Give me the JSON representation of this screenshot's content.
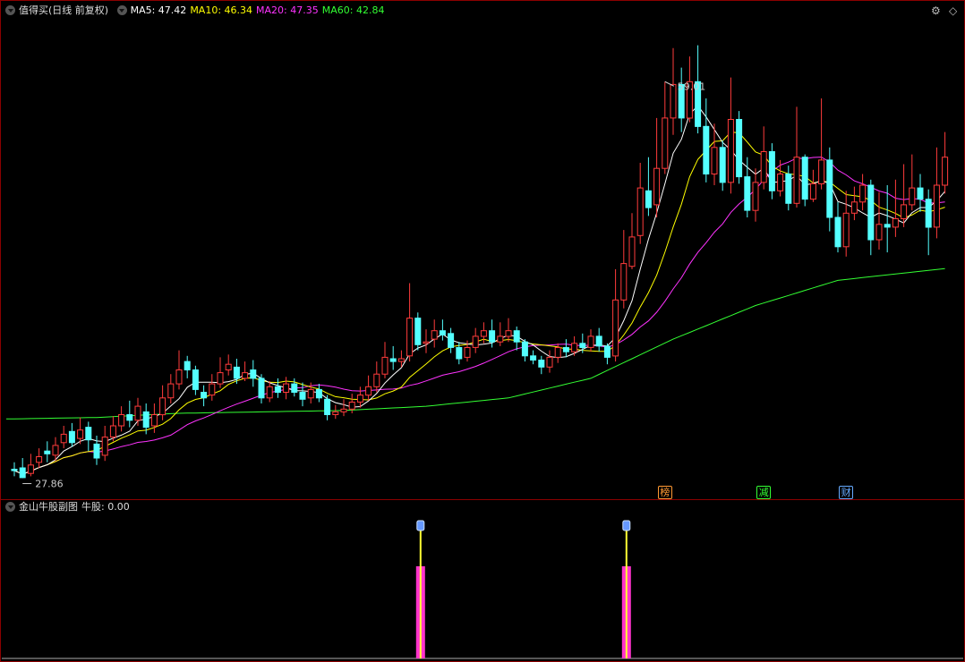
{
  "header": {
    "title": "值得买(日线 前复权)",
    "ma": [
      {
        "label": "MA5: 47.42",
        "color": "#ffffff"
      },
      {
        "label": "MA10: 46.34",
        "color": "#ffff00"
      },
      {
        "label": "MA20: 47.35",
        "color": "#ff33ff"
      },
      {
        "label": "MA60: 42.84",
        "color": "#33ff33"
      }
    ]
  },
  "sub_header": {
    "title": "金山牛股副图",
    "value_label": "牛股: 0.00"
  },
  "controls": {
    "settings_icon": "gear-icon",
    "diamond_icon": "diamond-icon"
  },
  "event_tags": [
    {
      "text": "榜",
      "color": "#ff9933",
      "candle_index": 79
    },
    {
      "text": "减",
      "color": "#33ff33",
      "candle_index": 91
    },
    {
      "text": "财",
      "color": "#66aaff",
      "candle_index": 101
    }
  ],
  "colors": {
    "up": "#ff3b3b",
    "down": "#54ffff",
    "background": "#000000",
    "border": "#8b0000"
  },
  "chart_data": {
    "type": "candlestick",
    "price_range": [
      27,
      60.5
    ],
    "max_label": "59.01",
    "min_label": "27.86",
    "max_index": 79,
    "min_index": 1,
    "candles": [
      [
        28.5,
        28.4,
        29.0,
        28.0
      ],
      [
        28.6,
        27.9,
        29.3,
        27.86
      ],
      [
        28.2,
        28.8,
        29.6,
        28.0
      ],
      [
        29.0,
        29.4,
        30.0,
        28.6
      ],
      [
        29.8,
        29.6,
        30.5,
        29.0
      ],
      [
        29.5,
        30.2,
        30.8,
        29.1
      ],
      [
        30.4,
        31.0,
        31.6,
        30.0
      ],
      [
        31.2,
        30.4,
        31.8,
        30.1
      ],
      [
        30.7,
        31.3,
        32.2,
        30.3
      ],
      [
        31.5,
        30.6,
        31.9,
        29.8
      ],
      [
        30.3,
        29.3,
        30.9,
        28.8
      ],
      [
        29.5,
        30.8,
        31.6,
        29.1
      ],
      [
        30.8,
        31.6,
        32.3,
        30.5
      ],
      [
        31.6,
        32.4,
        33.0,
        31.2
      ],
      [
        32.4,
        32.0,
        33.4,
        31.5
      ],
      [
        32.0,
        33.0,
        33.6,
        31.6
      ],
      [
        32.6,
        31.5,
        33.2,
        31.0
      ],
      [
        31.6,
        32.4,
        33.2,
        31.1
      ],
      [
        32.4,
        33.6,
        34.5,
        32.0
      ],
      [
        33.6,
        34.6,
        35.3,
        33.2
      ],
      [
        34.6,
        35.6,
        37.0,
        34.2
      ],
      [
        36.2,
        35.6,
        36.6,
        35.0
      ],
      [
        35.6,
        34.2,
        35.9,
        33.8
      ],
      [
        34.0,
        33.6,
        34.5,
        33.0
      ],
      [
        33.8,
        34.6,
        35.3,
        33.4
      ],
      [
        34.6,
        35.4,
        36.5,
        34.3
      ],
      [
        35.6,
        36.0,
        36.7,
        35.2
      ],
      [
        35.8,
        35.0,
        36.4,
        34.6
      ],
      [
        35.0,
        35.4,
        36.2,
        34.8
      ],
      [
        35.6,
        35.0,
        36.3,
        34.4
      ],
      [
        35.0,
        33.6,
        35.3,
        33.2
      ],
      [
        33.6,
        34.4,
        34.8,
        33.3
      ],
      [
        34.4,
        34.0,
        35.0,
        33.6
      ],
      [
        34.0,
        34.6,
        35.1,
        33.5
      ],
      [
        34.6,
        34.0,
        35.0,
        33.7
      ],
      [
        34.0,
        33.5,
        34.7,
        33.0
      ],
      [
        33.6,
        34.2,
        34.7,
        33.2
      ],
      [
        34.2,
        33.6,
        34.6,
        33.3
      ],
      [
        33.5,
        32.4,
        33.8,
        32.0
      ],
      [
        32.4,
        32.6,
        33.1,
        32.1
      ],
      [
        32.6,
        32.8,
        33.5,
        32.3
      ],
      [
        32.8,
        33.3,
        33.9,
        32.5
      ],
      [
        33.3,
        33.8,
        34.4,
        32.9
      ],
      [
        33.8,
        34.4,
        35.2,
        33.4
      ],
      [
        34.4,
        35.3,
        36.2,
        34.0
      ],
      [
        35.3,
        36.5,
        37.6,
        35.0
      ],
      [
        36.4,
        36.2,
        37.3,
        35.6
      ],
      [
        36.2,
        36.4,
        37.0,
        35.8
      ],
      [
        36.6,
        39.3,
        41.8,
        36.2
      ],
      [
        39.3,
        37.4,
        39.7,
        37.0
      ],
      [
        37.5,
        37.6,
        38.5,
        36.8
      ],
      [
        37.8,
        38.4,
        39.2,
        37.2
      ],
      [
        38.4,
        38.1,
        39.2,
        37.7
      ],
      [
        38.2,
        37.2,
        38.6,
        36.8
      ],
      [
        37.2,
        36.4,
        37.6,
        36.0
      ],
      [
        36.5,
        37.2,
        37.7,
        36.2
      ],
      [
        37.2,
        38.0,
        38.6,
        36.8
      ],
      [
        38.0,
        38.4,
        39.0,
        37.5
      ],
      [
        38.4,
        37.6,
        39.2,
        37.2
      ],
      [
        37.6,
        38.0,
        39.0,
        37.3
      ],
      [
        38.0,
        38.4,
        39.3,
        37.6
      ],
      [
        38.4,
        37.6,
        38.7,
        37.0
      ],
      [
        37.6,
        36.6,
        37.8,
        36.2
      ],
      [
        36.6,
        36.3,
        37.0,
        36.0
      ],
      [
        36.3,
        35.8,
        36.6,
        35.3
      ],
      [
        35.8,
        36.5,
        37.0,
        35.4
      ],
      [
        36.5,
        37.2,
        37.5,
        36.1
      ],
      [
        37.2,
        36.9,
        37.8,
        36.5
      ],
      [
        36.9,
        37.5,
        38.0,
        36.6
      ],
      [
        37.5,
        37.2,
        38.2,
        36.8
      ],
      [
        37.2,
        38.0,
        38.5,
        36.9
      ],
      [
        38.0,
        37.3,
        38.6,
        36.9
      ],
      [
        37.3,
        36.5,
        37.5,
        36.0
      ],
      [
        36.6,
        40.6,
        42.8,
        36.2
      ],
      [
        40.6,
        43.2,
        45.6,
        40.0
      ],
      [
        43.0,
        45.1,
        46.8,
        42.8
      ],
      [
        45.2,
        48.6,
        50.4,
        44.6
      ],
      [
        48.4,
        47.2,
        50.8,
        46.6
      ],
      [
        47.4,
        50.0,
        53.6,
        46.5
      ],
      [
        50.0,
        53.6,
        56.2,
        49.6
      ],
      [
        53.6,
        56.0,
        58.6,
        52.4
      ],
      [
        56.0,
        53.6,
        57.2,
        52.6
      ],
      [
        53.6,
        56.2,
        58.0,
        53.3
      ],
      [
        56.2,
        53.0,
        58.8,
        52.5
      ],
      [
        53.0,
        49.6,
        55.0,
        49.0
      ],
      [
        49.6,
        51.5,
        53.2,
        48.8
      ],
      [
        51.5,
        49.0,
        52.0,
        48.4
      ],
      [
        49.0,
        53.5,
        56.5,
        48.2
      ],
      [
        53.5,
        49.4,
        54.1,
        48.9
      ],
      [
        49.4,
        47.0,
        50.8,
        46.5
      ],
      [
        47.0,
        49.0,
        50.0,
        46.2
      ],
      [
        49.0,
        51.2,
        53.0,
        48.5
      ],
      [
        51.2,
        48.4,
        51.8,
        47.8
      ],
      [
        48.4,
        49.6,
        50.6,
        48.0
      ],
      [
        49.6,
        47.5,
        50.2,
        47.0
      ],
      [
        47.5,
        50.8,
        54.4,
        47.2
      ],
      [
        50.8,
        47.8,
        51.0,
        47.3
      ],
      [
        47.8,
        48.9,
        49.9,
        47.6
      ],
      [
        48.9,
        50.6,
        55.0,
        48.5
      ],
      [
        50.6,
        46.5,
        51.5,
        45.5
      ],
      [
        46.5,
        44.4,
        47.6,
        44.0
      ],
      [
        44.4,
        46.8,
        48.4,
        43.7
      ],
      [
        46.8,
        47.6,
        48.7,
        46.3
      ],
      [
        47.6,
        48.8,
        49.6,
        47.0
      ],
      [
        48.8,
        44.9,
        49.2,
        43.8
      ],
      [
        44.9,
        46.0,
        48.3,
        44.2
      ],
      [
        46.0,
        45.8,
        48.8,
        44.0
      ],
      [
        45.8,
        46.4,
        49.2,
        45.1
      ],
      [
        46.4,
        47.4,
        50.3,
        45.8
      ],
      [
        47.4,
        48.6,
        51.0,
        47.0
      ],
      [
        48.6,
        47.8,
        49.6,
        46.9
      ],
      [
        47.8,
        45.8,
        48.5,
        43.8
      ],
      [
        45.8,
        48.8,
        51.5,
        45.0
      ],
      [
        48.8,
        50.8,
        52.6,
        48.2
      ]
    ],
    "ma60": [
      [
        0,
        32.1
      ],
      [
        10,
        32.2
      ],
      [
        20,
        32.5
      ],
      [
        30,
        32.6
      ],
      [
        40,
        32.7
      ],
      [
        50,
        33.0
      ],
      [
        60,
        33.6
      ],
      [
        70,
        35.0
      ],
      [
        80,
        37.8
      ],
      [
        90,
        40.2
      ],
      [
        100,
        42.0
      ],
      [
        113,
        42.84
      ]
    ],
    "indicator": {
      "name": "牛股",
      "current": 0.0,
      "range": [
        0,
        1
      ],
      "signals": [
        {
          "index": 49,
          "value": 1
        },
        {
          "index": 74,
          "value": 1
        }
      ]
    }
  }
}
